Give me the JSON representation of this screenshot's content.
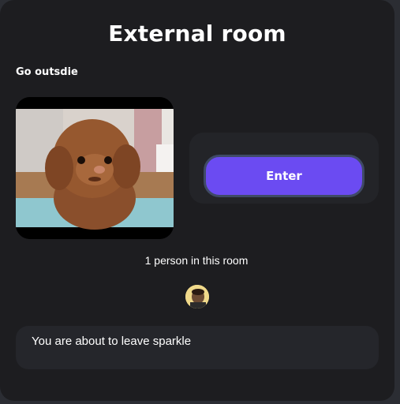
{
  "modal": {
    "title": "External room",
    "subtitle": "Go outsdie"
  },
  "room": {
    "image": "poodle-dog-photo",
    "enter_label": "Enter",
    "occupancy_text": "1 person in this room",
    "avatar": "user-avatar"
  },
  "notice": {
    "text": "You are about to leave sparkle"
  },
  "colors": {
    "modal_bg": "#1d1d20",
    "accent": "#6b4bf2",
    "panel_bg": "#25262b"
  }
}
